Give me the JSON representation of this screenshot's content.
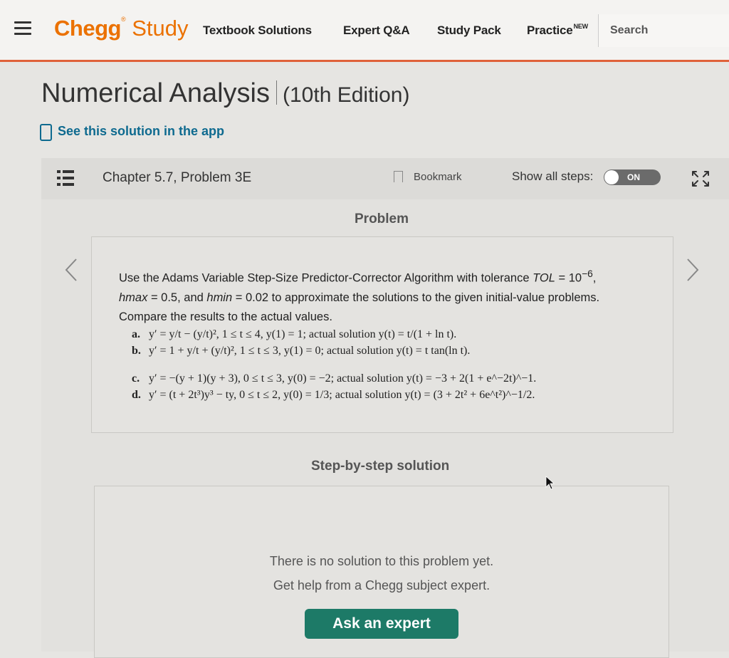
{
  "header": {
    "logo_brand": "Chegg",
    "logo_product": "Study",
    "nav": [
      {
        "label": "Textbook Solutions"
      },
      {
        "label": "Expert Q&A"
      },
      {
        "label": "Study Pack"
      },
      {
        "label": "Practice",
        "badge": "NEW"
      }
    ],
    "search_label": "Search",
    "accent_color": "#eb7100"
  },
  "book": {
    "title": "Numerical Analysis",
    "edition": "(10th Edition)",
    "app_link": "See this solution in the app"
  },
  "toolbar": {
    "chapter": "Chapter 5.7, Problem 3E",
    "bookmark_label": "Bookmark",
    "show_steps_label": "Show all steps:",
    "toggle_label": "ON"
  },
  "problem": {
    "heading": "Problem",
    "intro_part1": "Use the Adams Variable Step-Size Predictor-Corrector Algorithm with tolerance ",
    "tol_var": "TOL",
    "tol_eq": " = 10",
    "tol_exp": "−6",
    "comma": ",",
    "hmax_var": "hmax",
    "hmax_rest": " = 0.5, and ",
    "hmin_var": "hmin",
    "hmin_rest": " = 0.02 to approximate the solutions to the given initial-value problems. Compare the results to the actual values.",
    "items": [
      {
        "letter": "a.",
        "text": "y′ = y/t − (y/t)², 1 ≤ t ≤ 4, y(1) = 1; actual solution y(t) = t/(1 + ln t)."
      },
      {
        "letter": "b.",
        "text": "y′ = 1 + y/t + (y/t)², 1 ≤ t ≤ 3, y(1) = 0; actual solution y(t) = t tan(ln t)."
      },
      {
        "letter": "c.",
        "text": "y′ = −(y + 1)(y + 3), 0 ≤ t ≤ 3, y(0) = −2; actual solution y(t) = −3 + 2(1 + e^−2t)^−1."
      },
      {
        "letter": "d.",
        "text": "y′ = (t + 2t³)y³ − ty, 0 ≤ t ≤ 2, y(0) = 1/3; actual solution y(t) = (3 + 2t² + 6e^t²)^−1/2."
      }
    ]
  },
  "solution": {
    "heading": "Step-by-step solution",
    "empty_line1": "There is no solution to this problem yet.",
    "empty_line2": "Get help from a Chegg subject expert.",
    "button_label": "Ask an expert",
    "button_color": "#1d7a67"
  }
}
